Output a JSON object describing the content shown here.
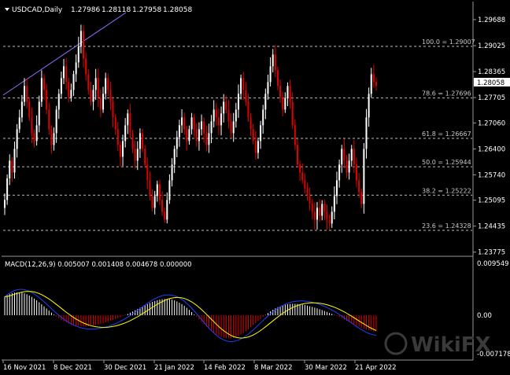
{
  "header": {
    "symbol": "USDCAD,Daily",
    "open": "1.27986",
    "high": "1.28118",
    "low": "1.27958",
    "close": "1.28058"
  },
  "current_price_tag": "1.28058",
  "price_axis": [
    "1.29688",
    "1.29025",
    "1.28365",
    "1.27705",
    "1.27060",
    "1.26400",
    "1.25740",
    "1.25095",
    "1.24435",
    "1.23775"
  ],
  "fib_levels": [
    {
      "label": "100.0 = 1.29007",
      "price": 1.29007
    },
    {
      "label": "78.6 = 1.27696",
      "price": 1.27696
    },
    {
      "label": "61.8 = 1.26667",
      "price": 1.26667
    },
    {
      "label": "50.0 = 1.25944",
      "price": 1.25944
    },
    {
      "label": "38.2 = 1.25222",
      "price": 1.25222
    },
    {
      "label": "23.6 = 1.24328",
      "price": 1.24328
    }
  ],
  "macd": {
    "label": "MACD(12,26,9) 0.005007 0.001408 0.004678 0.000000",
    "axis": [
      "0.009549",
      "0.00",
      "-0.007178"
    ]
  },
  "time_axis": [
    "16 Nov 2021",
    "8 Dec 2021",
    "30 Dec 2021",
    "21 Jan 2022",
    "14 Feb 2022",
    "8 Mar 2022",
    "30 Mar 2022",
    "21 Apr 2022"
  ],
  "watermark": "WikiFX",
  "colors": {
    "background": "#000000",
    "bull": "#ffffff",
    "bear": "#e00000",
    "grid": "#bcbcbc",
    "trendline": "#9a6cff",
    "signal": "#ffff00",
    "macd_line": "#1f3fff",
    "hist_pos": "#ffffff",
    "hist_neg": "#e00000"
  },
  "chart_data": {
    "type": "candlestick",
    "symbol": "USDCAD",
    "timeframe": "Daily",
    "y_range": [
      1.235,
      1.299
    ],
    "closes": [
      1.251,
      1.2565,
      1.261,
      1.258,
      1.264,
      1.269,
      1.272,
      1.276,
      1.28,
      1.276,
      1.272,
      1.268,
      1.266,
      1.27,
      1.276,
      1.282,
      1.279,
      1.274,
      1.269,
      1.265,
      1.268,
      1.274,
      1.278,
      1.282,
      1.285,
      1.281,
      1.277,
      1.279,
      1.283,
      1.286,
      1.29,
      1.294,
      1.287,
      1.283,
      1.279,
      1.276,
      1.279,
      1.282,
      1.277,
      1.274,
      1.278,
      1.282,
      1.279,
      1.276,
      1.272,
      1.269,
      1.265,
      1.262,
      1.266,
      1.27,
      1.273,
      1.268,
      1.264,
      1.261,
      1.264,
      1.268,
      1.264,
      1.26,
      1.256,
      1.252,
      1.249,
      1.252,
      1.255,
      1.251,
      1.248,
      1.246,
      1.251,
      1.256,
      1.26,
      1.264,
      1.267,
      1.27,
      1.272,
      1.269,
      1.266,
      1.269,
      1.272,
      1.269,
      1.266,
      1.269,
      1.271,
      1.268,
      1.265,
      1.268,
      1.271,
      1.274,
      1.272,
      1.27,
      1.273,
      1.276,
      1.274,
      1.271,
      1.268,
      1.271,
      1.274,
      1.278,
      1.282,
      1.279,
      1.276,
      1.272,
      1.269,
      1.266,
      1.263,
      1.266,
      1.27,
      1.274,
      1.278,
      1.281,
      1.285,
      1.288,
      1.284,
      1.28,
      1.277,
      1.274,
      1.277,
      1.28,
      1.276,
      1.27,
      1.265,
      1.26,
      1.258,
      1.256,
      1.254,
      1.252,
      1.25,
      1.248,
      1.246,
      1.249,
      1.247,
      1.25,
      1.248,
      1.246,
      1.245,
      1.248,
      1.252,
      1.256,
      1.26,
      1.264,
      1.261,
      1.258,
      1.261,
      1.264,
      1.26,
      1.256,
      1.253,
      1.25,
      1.264,
      1.272,
      1.278,
      1.283,
      1.281,
      1.28
    ]
  }
}
